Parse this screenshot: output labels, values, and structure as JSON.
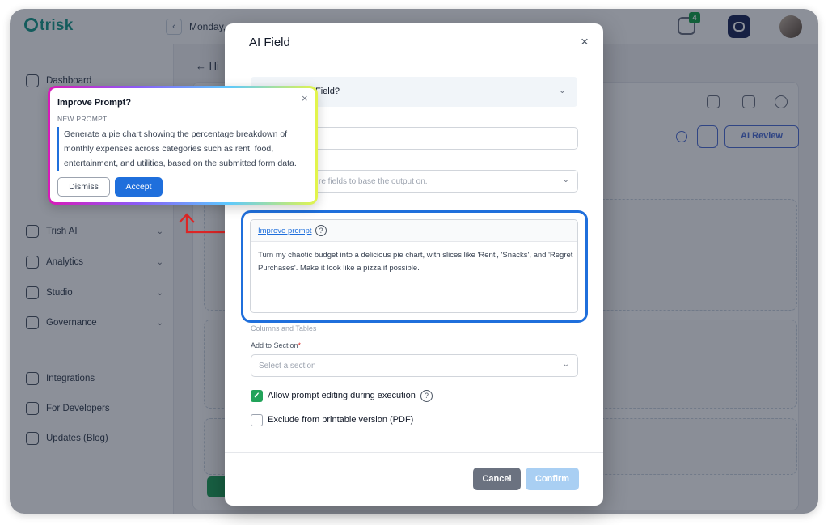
{
  "app": {
    "logo": "trisk",
    "date": "Monday,",
    "chat_badge": "4"
  },
  "sidebar": {
    "items": [
      {
        "label": "Dashboard",
        "icon": "dashboard-icon"
      },
      {
        "label": "Trish AI",
        "icon": "chat-bubble-icon"
      },
      {
        "label": "Analytics",
        "icon": "analytics-icon"
      },
      {
        "label": "Studio",
        "icon": "edit-icon"
      },
      {
        "label": "Governance",
        "icon": "bank-icon"
      },
      {
        "label": "Integrations",
        "icon": "puzzle-icon"
      },
      {
        "label": "For Developers",
        "icon": "code-icon"
      },
      {
        "label": "Updates (Blog)",
        "icon": "arrow-up-circle-icon"
      }
    ]
  },
  "workspace": {
    "back_label": "← Hi",
    "ai_review": "AI Review"
  },
  "modal": {
    "title": "AI Field",
    "close": "×",
    "accordion_text": "Field?",
    "fields_placeholder": "re fields to base the output on.",
    "improve_prompt_link": "Improve prompt",
    "help_glyph": "?",
    "prompt_text": "Turn my chaotic budget into a delicious pie chart, with slices like 'Rent', 'Snacks', and 'Regret Purchases'. Make it look like a pizza if possible.",
    "columns_label": "Columns and Tables",
    "section_label": "Add to Section",
    "section_required": "*",
    "section_placeholder": "Select a section",
    "allow_editing_label": "Allow prompt editing during execution",
    "allow_editing_checked": true,
    "exclude_pdf_label": "Exclude from printable version (PDF)",
    "exclude_pdf_checked": false,
    "cancel": "Cancel",
    "confirm": "Confirm"
  },
  "popover": {
    "title": "Improve Prompt?",
    "close": "×",
    "subtitle": "NEW PROMPT",
    "body": "Generate a pie chart showing the percentage breakdown of monthly expenses across categories such as rent, food, entertainment, and utilities, based on the submitted form data.",
    "dismiss": "Dismiss",
    "accept": "Accept"
  },
  "colors": {
    "accent": "#1f6fdc",
    "success": "#22a35a",
    "annotation_arrow": "#dc2626"
  }
}
